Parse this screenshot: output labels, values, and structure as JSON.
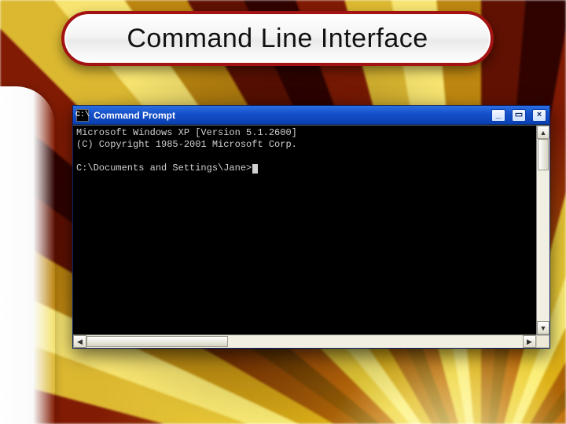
{
  "slide": {
    "title": "Command Line Interface"
  },
  "window": {
    "title": "Command Prompt",
    "icon_label": "C:\\",
    "minimize_label": "_",
    "maximize_label": "▭",
    "close_label": "×"
  },
  "console": {
    "line1": "Microsoft Windows XP [Version 5.1.2600]",
    "line2": "(C) Copyright 1985-2001 Microsoft Corp.",
    "blank": "",
    "prompt": "C:\\Documents and Settings\\Jane>"
  },
  "scroll": {
    "up": "▲",
    "down": "▼",
    "left": "◀",
    "right": "▶"
  }
}
